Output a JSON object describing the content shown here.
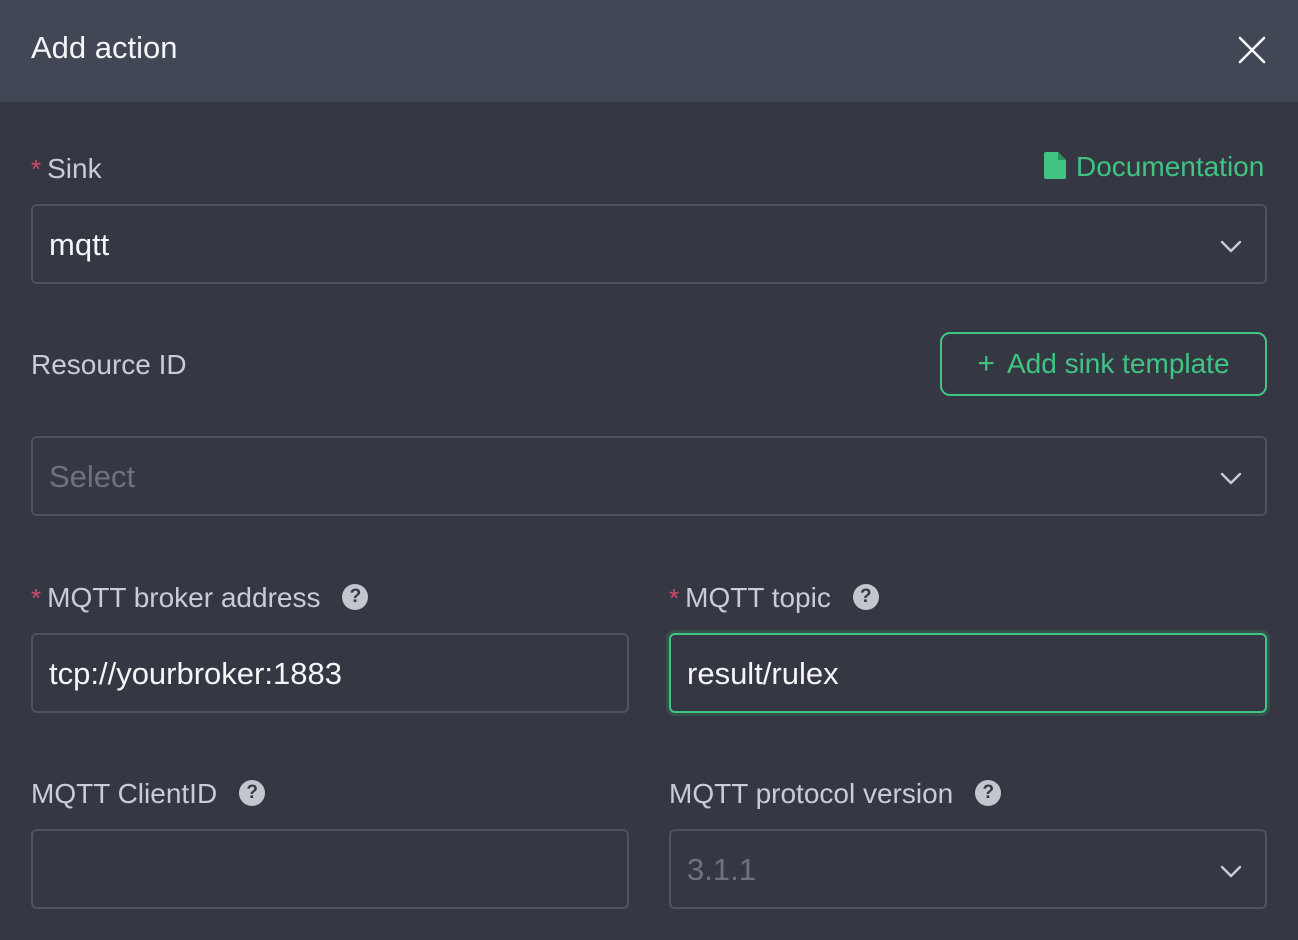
{
  "dialog": {
    "title": "Add action"
  },
  "sink": {
    "label": "Sink",
    "required_mark": "*",
    "value": "mqtt",
    "doc_link": "Documentation"
  },
  "resource": {
    "label": "Resource ID",
    "placeholder": "Select",
    "add_template_label": "Add sink template",
    "add_template_icon": "+"
  },
  "broker": {
    "label": "MQTT broker address",
    "required_mark": "*",
    "value": "tcp://yourbroker:1883",
    "help": "?"
  },
  "topic": {
    "label": "MQTT topic",
    "required_mark": "*",
    "value": "result/rulex",
    "help": "?"
  },
  "client_id": {
    "label": "MQTT ClientID",
    "value": "",
    "help": "?"
  },
  "protocol": {
    "label": "MQTT protocol version",
    "placeholder": "3.1.1",
    "help": "?"
  },
  "colors": {
    "accent": "#3fc482",
    "required": "#d04a6a",
    "background": "#353843",
    "header": "#424756"
  }
}
